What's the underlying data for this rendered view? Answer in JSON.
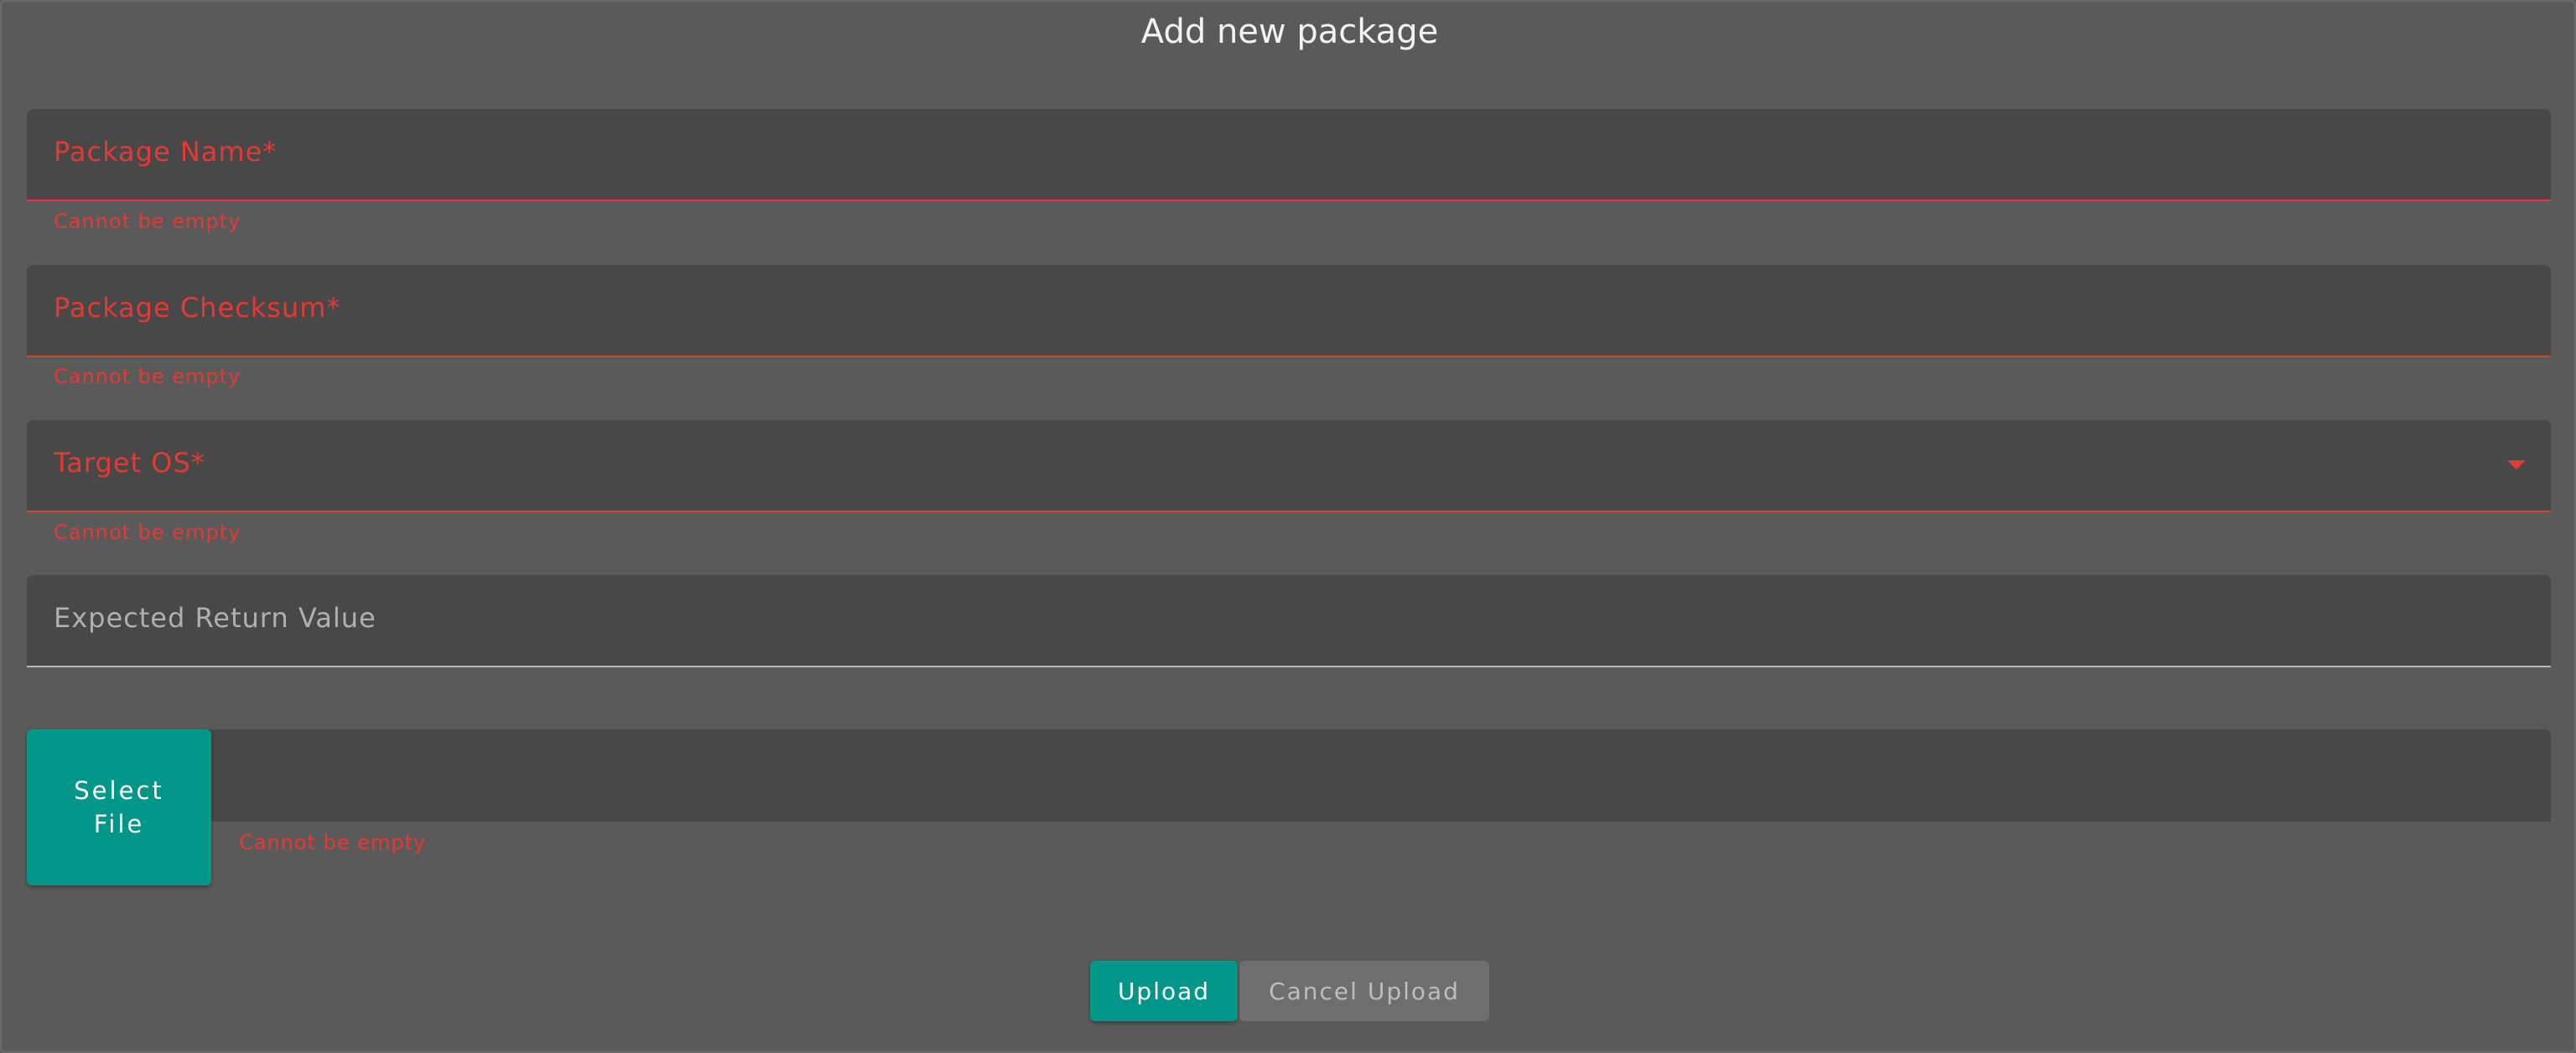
{
  "dialog": {
    "title": "Add new package"
  },
  "fields": {
    "package_name": {
      "label": "Package Name*",
      "error": "Cannot be empty"
    },
    "package_checksum": {
      "label": "Package Checksum*",
      "error": "Cannot be empty"
    },
    "target_os": {
      "label": "Target OS*",
      "error": "Cannot be empty",
      "icon": "dropdown-arrow-icon"
    },
    "expected_return_value": {
      "label": "Expected Return Value"
    }
  },
  "file_select": {
    "button_label": "Select File",
    "error": "Cannot be empty"
  },
  "actions": {
    "upload_label": "Upload",
    "cancel_label": "Cancel Upload"
  },
  "colors": {
    "background": "#5a5a5a",
    "field_background": "#484848",
    "error": "#e53935",
    "accent": "#009688"
  }
}
